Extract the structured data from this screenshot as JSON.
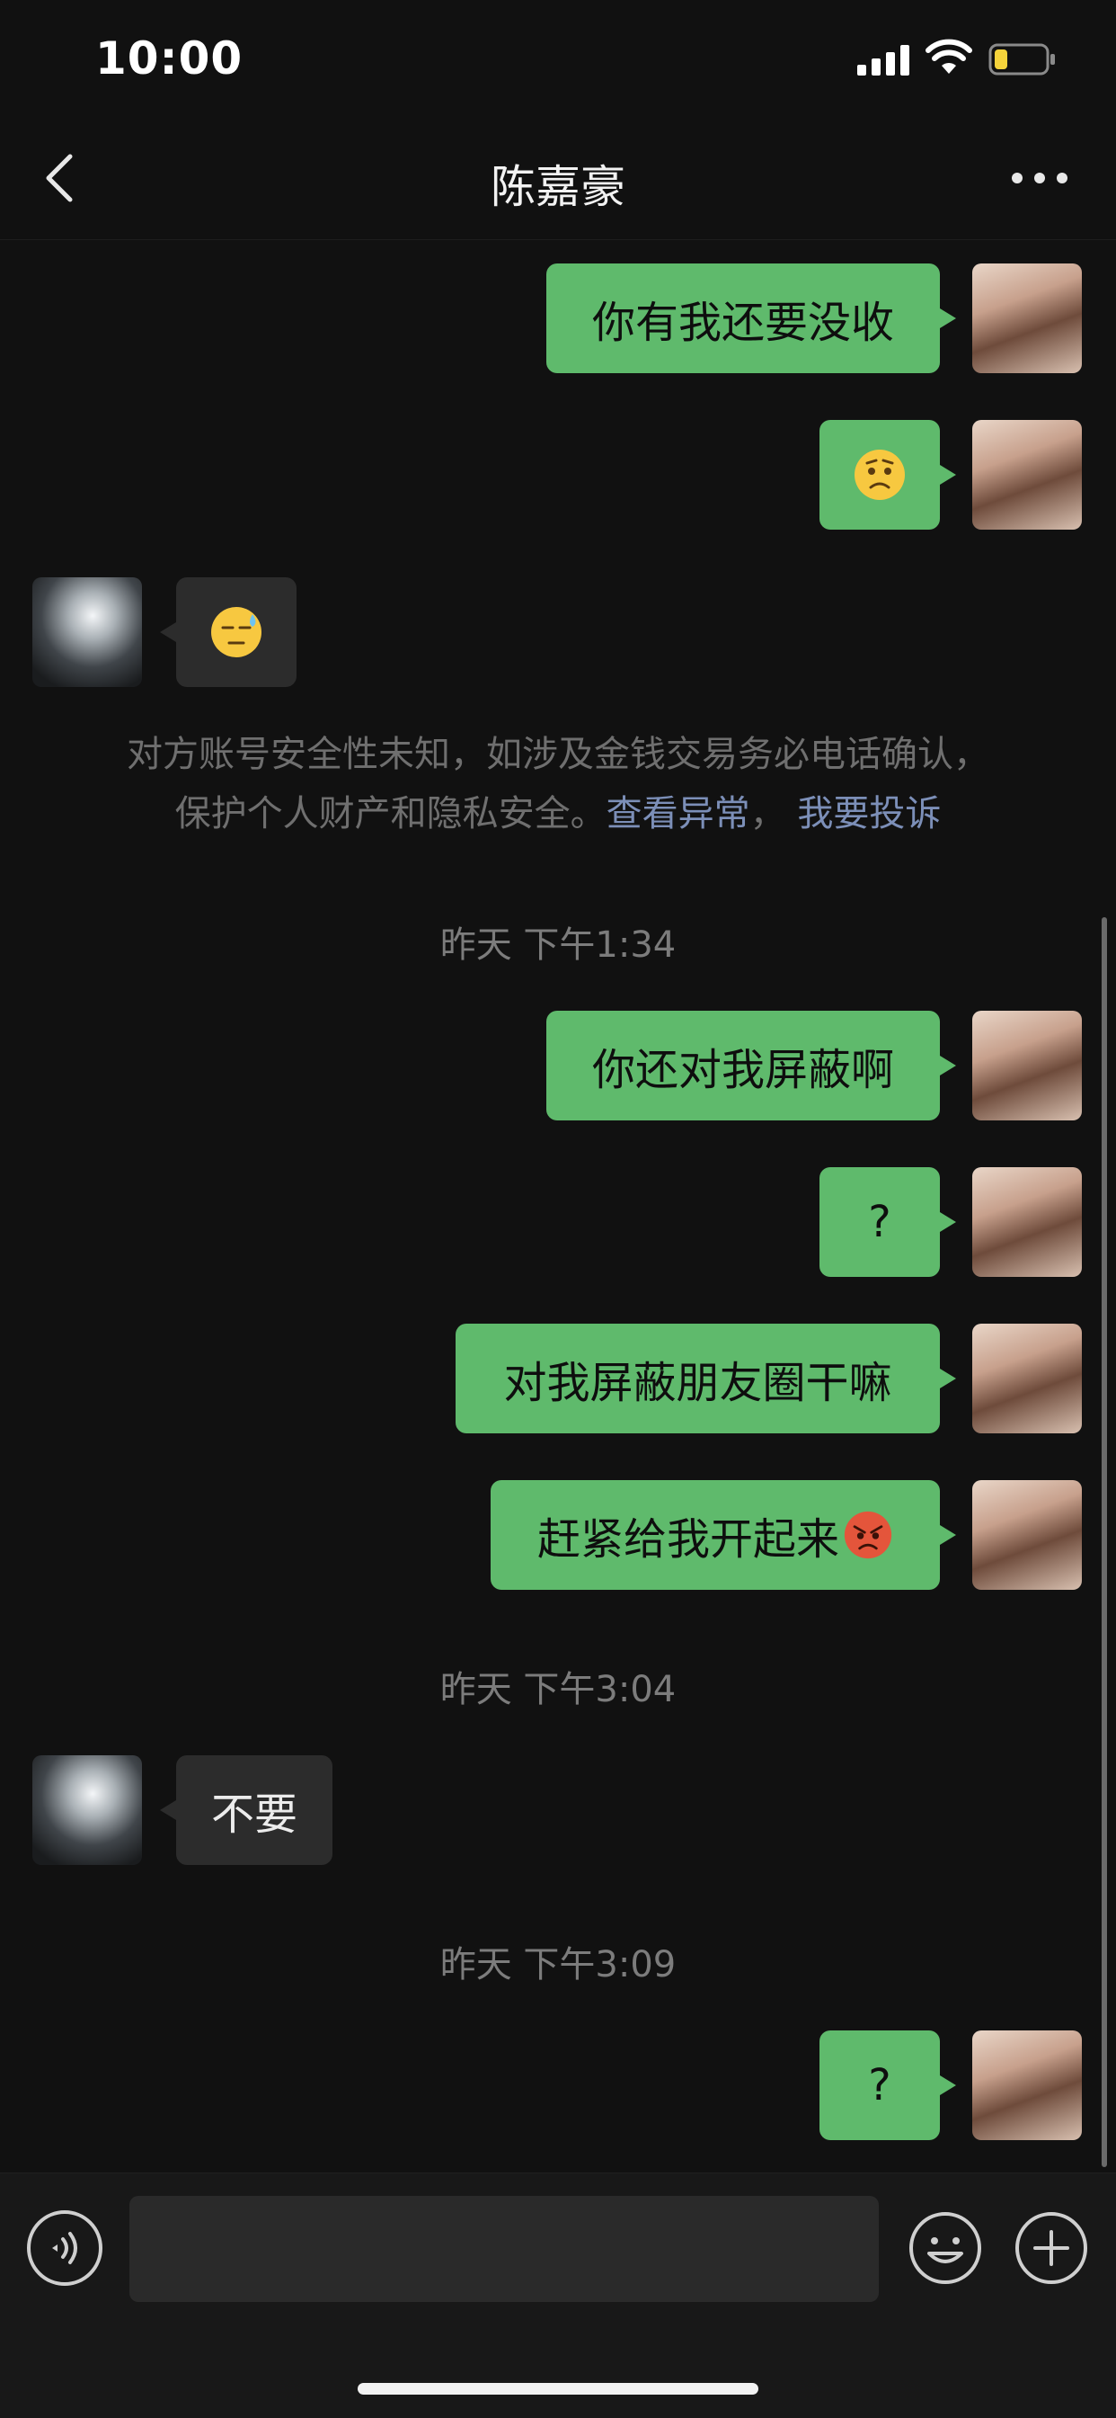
{
  "status_bar": {
    "time": "10:00"
  },
  "header": {
    "title": "陈嘉豪"
  },
  "messages": [
    {
      "side": "me",
      "text": "你有我还要没收"
    },
    {
      "side": "me",
      "emoji": "confused-face"
    },
    {
      "side": "other",
      "emoji": "sweat-face"
    },
    {
      "side": "me",
      "text": "你还对我屏蔽啊"
    },
    {
      "side": "me",
      "text": "?"
    },
    {
      "side": "me",
      "text": "对我屏蔽朋友圈干嘛"
    },
    {
      "side": "me",
      "text": "赶紧给我开起来",
      "emoji": "angry-face"
    },
    {
      "side": "other",
      "text": "不要"
    },
    {
      "side": "me",
      "text": "?"
    }
  ],
  "notice": {
    "line1": "对方账号安全性未知，如涉及金钱交易务必电话确认，",
    "line2_prefix": "保护个人财产和隐私安全。",
    "link_view": "查看异常",
    "separator": "，",
    "link_report": "我要投诉"
  },
  "timestamps": [
    "昨天 下午1:34",
    "昨天 下午3:04",
    "昨天 下午3:09"
  ],
  "input": {
    "value": ""
  },
  "icons": {
    "back": "chevron-left-icon",
    "more": "ellipsis-icon",
    "voice": "voice-icon",
    "emoji": "smiley-icon",
    "plus": "plus-icon"
  },
  "colors": {
    "background": "#111111",
    "my_bubble": "#5fba6c",
    "their_bubble": "#2c2c2c",
    "link": "#7c8fb8"
  }
}
